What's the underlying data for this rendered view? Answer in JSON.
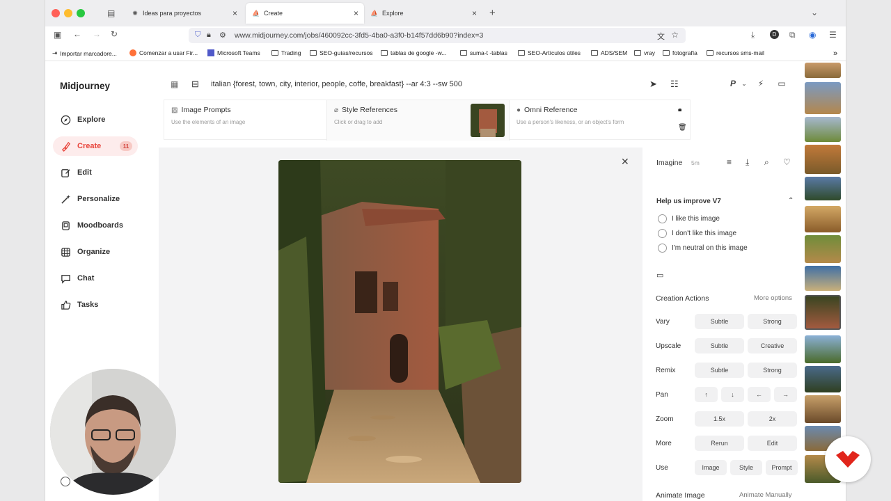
{
  "browser": {
    "tabs": [
      {
        "label": "Ideas para proyectos"
      },
      {
        "label": "Create"
      },
      {
        "label": "Explore"
      }
    ],
    "url": "www.midjourney.com/jobs/460092cc-3fd5-4ba0-a3f0-b14f57dd6b90?index=3",
    "bookmarks": [
      "Importar marcadore...",
      "Comenzar a usar Fir...",
      "Microsoft Teams",
      "Trading",
      "SEO-guías/recursos",
      "tablas de google -w...",
      "suma-t -tablas",
      "SEO-Artículos útiles",
      "ADS/SEM",
      "vray",
      "fotografía",
      "recursos sms-mail"
    ]
  },
  "sidebar": {
    "brand": "Midjourney",
    "items": [
      {
        "label": "Explore",
        "icon": "compass-icon"
      },
      {
        "label": "Create",
        "icon": "brush-icon",
        "badge": "11"
      },
      {
        "label": "Edit",
        "icon": "edit-icon"
      },
      {
        "label": "Personalize",
        "icon": "wand-icon"
      },
      {
        "label": "Moodboards",
        "icon": "moodboard-icon"
      },
      {
        "label": "Organize",
        "icon": "grid-icon"
      },
      {
        "label": "Chat",
        "icon": "chat-icon"
      },
      {
        "label": "Tasks",
        "icon": "thumbs-up-icon"
      }
    ]
  },
  "prompt": {
    "text": "italian {forest, town, city, interior, people, coffe, breakfast} --ar 4:3 --sw 500"
  },
  "references": {
    "image_prompts": {
      "title": "Image Prompts",
      "sub": "Use the elements of an image"
    },
    "style_references": {
      "title": "Style References",
      "sub": "Click or drag to add"
    },
    "omni_reference": {
      "title": "Omni Reference",
      "sub": "Use a person's likeness, or an object's form"
    }
  },
  "toolbar": {
    "p_label": "P"
  },
  "panel": {
    "title": "Imagine",
    "time": "5m",
    "feedback_title": "Help us improve V7",
    "feedback_options": [
      "I like this image",
      "I don't like this image",
      "I'm neutral on this image"
    ],
    "creation_actions": "Creation Actions",
    "more_options": "More options",
    "rows": [
      {
        "label": "Vary",
        "buttons": [
          "Subtle",
          "Strong"
        ]
      },
      {
        "label": "Upscale",
        "buttons": [
          "Subtle",
          "Creative"
        ]
      },
      {
        "label": "Remix",
        "buttons": [
          "Subtle",
          "Strong"
        ]
      },
      {
        "label": "Pan",
        "buttons": [
          "↑",
          "↓",
          "←",
          "→"
        ]
      },
      {
        "label": "Zoom",
        "buttons": [
          "1.5x",
          "2x"
        ]
      },
      {
        "label": "More",
        "buttons": [
          "Rerun",
          "Edit"
        ]
      },
      {
        "label": "Use",
        "buttons": [
          "Image",
          "Style",
          "Prompt"
        ]
      }
    ],
    "animate_title": "Animate Image",
    "animate_manually": "Animate Manually"
  },
  "colors": {
    "accent": "#e8453c",
    "active_bg": "#fdecec"
  }
}
